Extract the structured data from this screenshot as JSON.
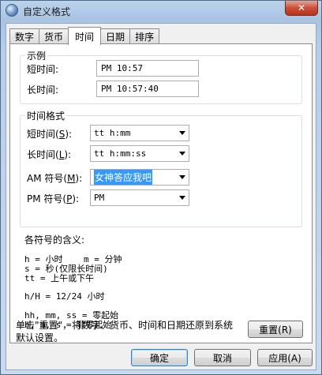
{
  "window": {
    "title": "自定义格式",
    "close_label": "✕"
  },
  "tabs": [
    {
      "label": "数字"
    },
    {
      "label": "货币"
    },
    {
      "label": "时间"
    },
    {
      "label": "日期"
    },
    {
      "label": "排序"
    }
  ],
  "example": {
    "legend": "示例",
    "short_label": "短时间:",
    "short_value": "PM 10:57",
    "long_label": "长时间:",
    "long_value": "PM 10:57:40"
  },
  "formats": {
    "legend": "时间格式",
    "short_label_main": "短时间(",
    "short_label_key": "S",
    "short_label_tail": "):",
    "short_value": "tt h:mm",
    "long_label_main": "长时间(",
    "long_label_key": "L",
    "long_label_tail": "):",
    "long_value": "tt h:mm:ss",
    "am_label_main": "AM 符号(",
    "am_label_key": "M",
    "am_label_tail": "):",
    "am_value": "女神答应我吧",
    "pm_label_main": "PM 符号(",
    "pm_label_key": "P",
    "pm_label_tail": "):",
    "pm_value": "PM"
  },
  "help": {
    "heading": "各符号的含义:",
    "line1": "h = 小时    m = 分钟",
    "line2": "s = 秒(仅限长时间)",
    "line3": "tt = 上午或下午",
    "line4": "h/H = 12/24 小时",
    "line5": "hh, mm, ss = 零起始",
    "line6": "h, m, s = 非零起始"
  },
  "reset_hint": "单击\"重置\"，将数字、货币、时间和日期还原到系统默认设置。",
  "buttons": {
    "reset": "重置(R)",
    "ok": "确定",
    "cancel": "取消",
    "apply": "应用(A)"
  }
}
